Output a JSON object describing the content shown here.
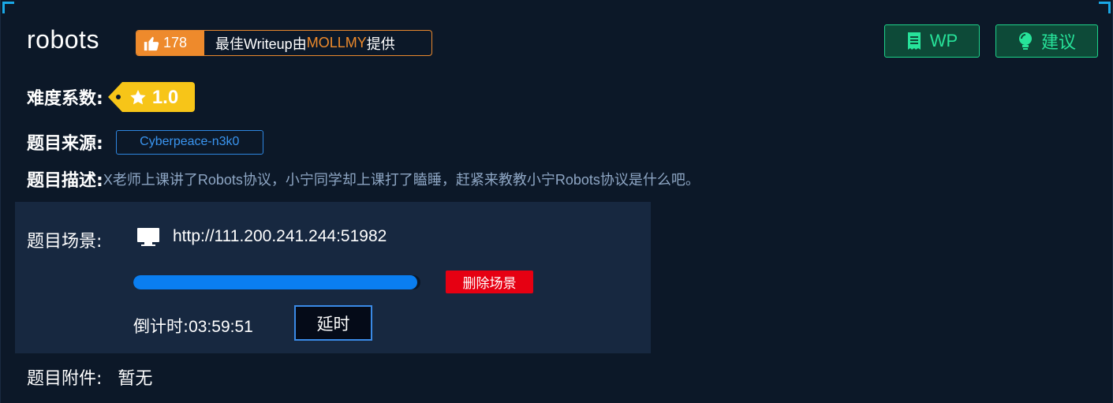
{
  "challenge": {
    "title": "robots",
    "likes": "178",
    "best_writeup_prefix": "最佳Writeup由",
    "best_writeup_author": "MOLLMY",
    "best_writeup_suffix": "提供"
  },
  "toolbar": {
    "wp_label": "WP",
    "suggest_label": "建议"
  },
  "info": {
    "difficulty_label": "难度系数:",
    "difficulty_value": "1.0",
    "source_label": "题目来源:",
    "source_value": "Cyberpeace-n3k0",
    "desc_label": "题目描述:",
    "desc_value": "X老师上课讲了Robots协议，小宁同学却上课打了瞌睡，赶紧来教教小宁Robots协议是什么吧。",
    "attach_label": "题目附件:",
    "attach_value": "暂无"
  },
  "scene": {
    "label": "题目场景:",
    "url": "http://111.200.241.244:51982",
    "progress": 0.99,
    "delete_label": "删除场景",
    "countdown_label": "倒计时:",
    "countdown_value": "03:59:51",
    "delay_label": "延时"
  },
  "colors": {
    "accent_orange": "#ee8a2c",
    "green": "#27e39a",
    "blue": "#0a7ef0",
    "red": "#e60012",
    "gold": "#f7c518"
  },
  "icons": [
    "thumbs-up-icon",
    "document-icon",
    "lightbulb-icon",
    "star-icon",
    "monitor-icon"
  ]
}
